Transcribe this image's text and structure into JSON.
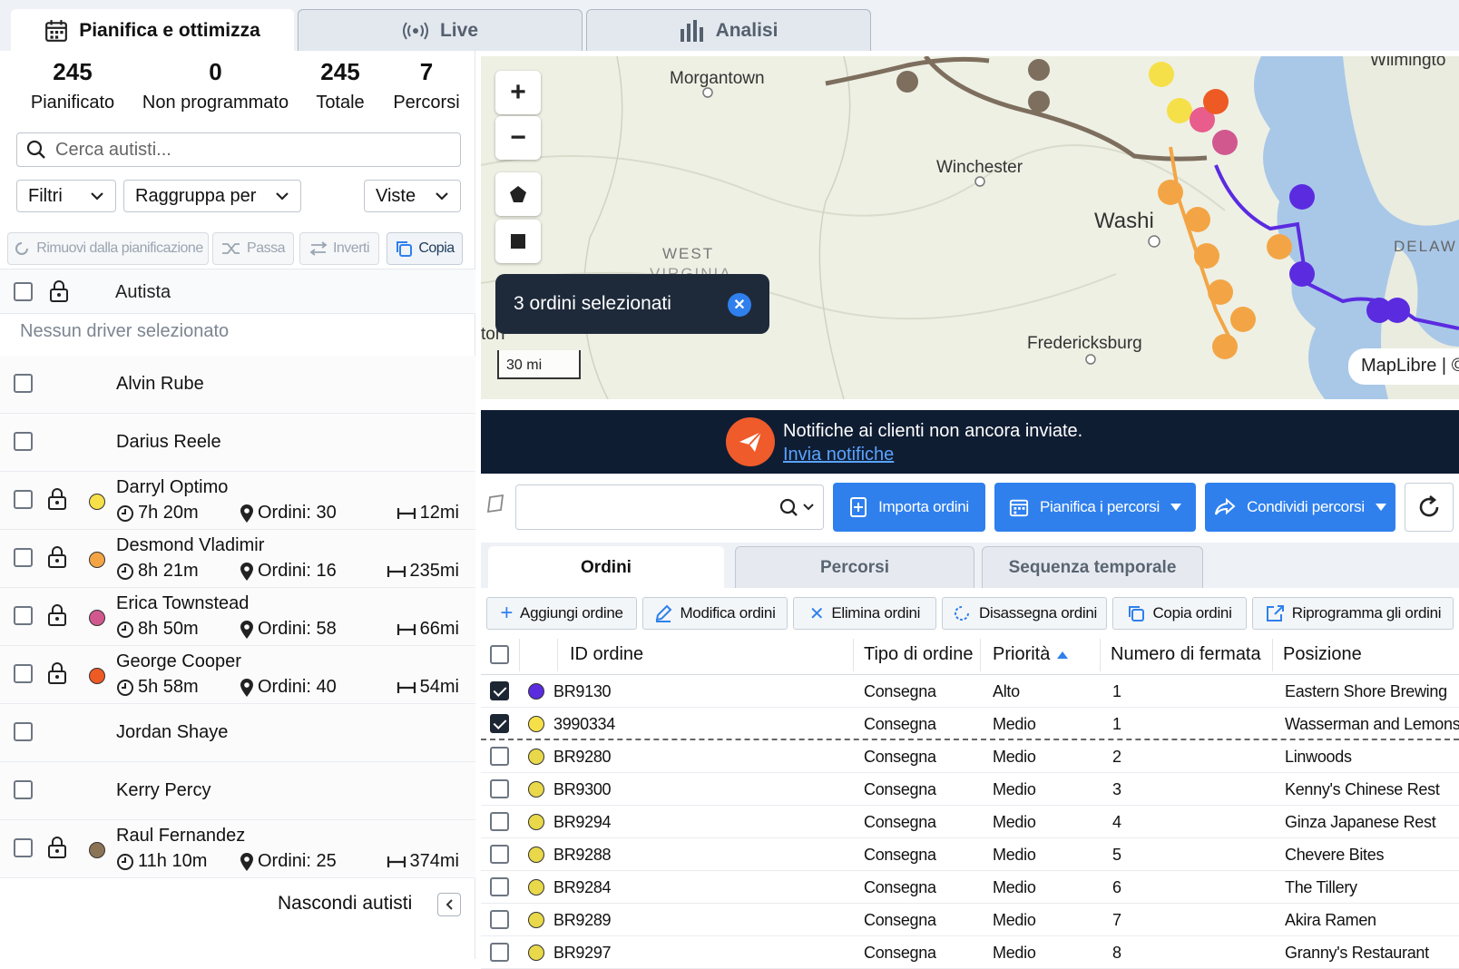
{
  "top_tabs": [
    {
      "label": "Pianifica e ottimizza",
      "icon": "calendar-icon",
      "active": true
    },
    {
      "label": "Live",
      "icon": "broadcast-icon",
      "active": false
    },
    {
      "label": "Analisi",
      "icon": "bar-chart-icon",
      "active": false
    }
  ],
  "stats": [
    {
      "value": "245",
      "label": "Pianificato"
    },
    {
      "value": "0",
      "label": "Non programmato"
    },
    {
      "value": "245",
      "label": "Totale"
    },
    {
      "value": "7",
      "label": "Percorsi"
    }
  ],
  "driver_search": {
    "placeholder": "Cerca autisti..."
  },
  "dropdowns": {
    "filters": "Filtri",
    "group_by": "Raggruppa per",
    "views": "Viste"
  },
  "actions": {
    "remove": "Rimuovi dalla pianificazione",
    "pass": "Passa",
    "invert": "Inverti",
    "copy": "Copia"
  },
  "driver_header": "Autista",
  "no_driver": "Nessun driver selezionato",
  "drivers": [
    {
      "name": "Alvin Rube"
    },
    {
      "name": "Darius Reele"
    },
    {
      "name": "Darryl Optimo",
      "color": "#f5e04a",
      "time": "7h 20m",
      "orders": "Ordini: 30",
      "distance": "12mi"
    },
    {
      "name": "Desmond Vladimir",
      "color": "#f3a545",
      "time": "8h 21m",
      "orders": "Ordini: 16",
      "distance": "235mi"
    },
    {
      "name": "Erica Townstead",
      "color": "#d0588f",
      "time": "8h 50m",
      "orders": "Ordini: 58",
      "distance": "66mi"
    },
    {
      "name": "George Cooper",
      "color": "#ee5a24",
      "time": "5h 58m",
      "orders": "Ordini: 40",
      "distance": "54mi"
    },
    {
      "name": "Jordan Shaye"
    },
    {
      "name": "Kerry Percy"
    },
    {
      "name": "Raul Fernandez",
      "color": "#8b7355",
      "time": "11h 10m",
      "orders": "Ordini: 25",
      "distance": "374mi"
    }
  ],
  "hide_drivers": "Nascondi autisti",
  "map": {
    "toast": "3 ordini selezionati",
    "scale": "30 mi",
    "attribution": "MapLibre | ©",
    "cities": [
      "Morgantown",
      "Winchester",
      "Washi",
      "Fredericksburg",
      "Wilmingto",
      "WEST",
      "VIRGINIA",
      "DELAW",
      "ton"
    ]
  },
  "notification": {
    "text": "Notifiche ai clienti non ancora inviate.",
    "link": "Invia notifiche"
  },
  "order_search": {
    "placeholder": ""
  },
  "toolbar": {
    "import": "Importa ordini",
    "plan": "Pianifica i percorsi",
    "share": "Condividi percorsi"
  },
  "sub_tabs": [
    "Ordini",
    "Percorsi",
    "Sequenza temporale"
  ],
  "order_actions": [
    "Aggiungi ordine",
    "Modifica ordini",
    "Elimina ordini",
    "Disassegna ordini",
    "Copia ordini",
    "Riprogramma gli ordini"
  ],
  "table": {
    "headers": [
      "ID ordine",
      "Tipo di ordine",
      "Priorità",
      "Numero di fermata",
      "Posizione"
    ],
    "rows": [
      {
        "id": "BR9130",
        "type": "Consegna",
        "priority": "Alto",
        "stop": "1",
        "location": "Eastern Shore Brewing",
        "checked": true,
        "color": "#5b2be0"
      },
      {
        "id": "3990334",
        "type": "Consegna",
        "priority": "Medio",
        "stop": "1",
        "location": "Wasserman and Lemons",
        "checked": true,
        "color": "#f5e04a"
      },
      {
        "id": "BR9280",
        "type": "Consegna",
        "priority": "Medio",
        "stop": "2",
        "location": "Linwoods",
        "checked": false,
        "color": "#e8d84a"
      },
      {
        "id": "BR9300",
        "type": "Consegna",
        "priority": "Medio",
        "stop": "3",
        "location": "Kenny's Chinese Rest",
        "checked": false,
        "color": "#e8d84a"
      },
      {
        "id": "BR9294",
        "type": "Consegna",
        "priority": "Medio",
        "stop": "4",
        "location": "Ginza Japanese Rest",
        "checked": false,
        "color": "#e8d84a"
      },
      {
        "id": "BR9288",
        "type": "Consegna",
        "priority": "Medio",
        "stop": "5",
        "location": "Chevere Bites",
        "checked": false,
        "color": "#e8d84a"
      },
      {
        "id": "BR9284",
        "type": "Consegna",
        "priority": "Medio",
        "stop": "6",
        "location": "The Tillery",
        "checked": false,
        "color": "#e8d84a"
      },
      {
        "id": "BR9289",
        "type": "Consegna",
        "priority": "Medio",
        "stop": "7",
        "location": "Akira Ramen",
        "checked": false,
        "color": "#e8d84a"
      },
      {
        "id": "BR9297",
        "type": "Consegna",
        "priority": "Medio",
        "stop": "8",
        "location": "Granny's Restaurant",
        "checked": false,
        "color": "#e8d84a"
      }
    ]
  }
}
